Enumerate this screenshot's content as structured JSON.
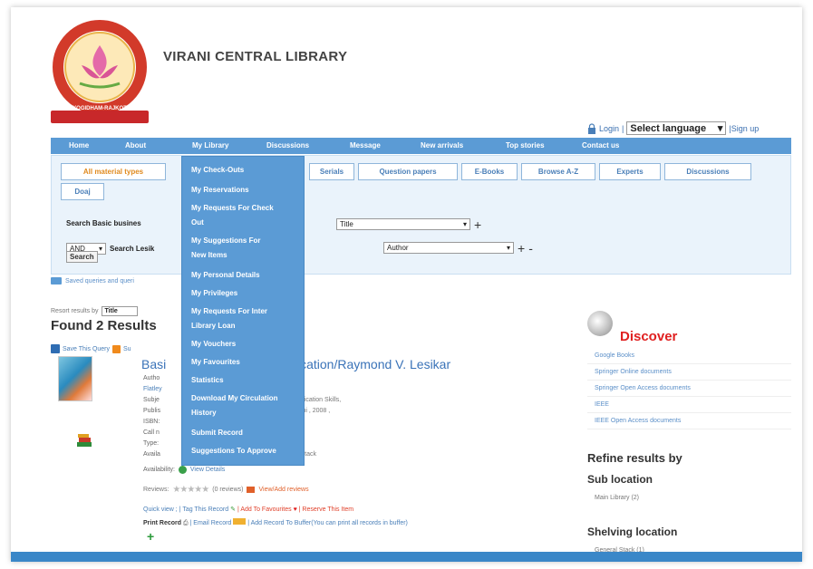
{
  "header": {
    "title": "VIRANI CENTRAL LIBRARY",
    "logo_top_text": "SARVODAY KELAVANI SAMAJ",
    "logo_bottom_text": "YOGIDHAM-RAJKOT",
    "login_label": "Login",
    "language_select": "Select language",
    "signup_label": "|Sign up"
  },
  "nav": {
    "items": [
      "Home",
      "About",
      "My Library",
      "Discussions",
      "Message",
      "New arrivals",
      "Top stories",
      "Contact us"
    ]
  },
  "tabs": [
    "All material types",
    "Serials",
    "Question papers",
    "E-Books",
    "Browse A-Z",
    "Experts",
    "Discussions"
  ],
  "tab_doaj": "Doaj",
  "search": {
    "row1_label": "Search Basic busines",
    "row1_field": "Title",
    "row2_op": "AND",
    "row2_label": "Search Lesik",
    "row2_field": "Author",
    "button": "Search",
    "plus": "+",
    "minus": "-"
  },
  "saved_queries": "Saved queries and queri",
  "resort": {
    "label": "Resort results by",
    "value": "Title"
  },
  "found": "Found 2 Results",
  "save_query": {
    "label": "Save This Query",
    "rss": "Su"
  },
  "record": {
    "title_left": "Basi",
    "title_right": "ication/Raymond V. Lesikar",
    "fields_left": [
      "Autho",
      "Flatley",
      "Subje",
      "Publis",
      "ISBN:",
      "Call n",
      "Type:",
      "Availa"
    ],
    "fields_right": [
      "unication Skills,",
      "elhi , 2008 ,",
      "l Stack"
    ],
    "availability_label": "Availability:",
    "availability_link": "View Details",
    "reviews_label": "Reviews:",
    "reviews_stars": "★★★★★",
    "reviews_count": "(0 reviews)",
    "reviews_link": "View/Add reviews",
    "quick_view": "Quick view ; | Tag This Record",
    "add_favourites": "| Add To Favourites",
    "reserve": "| Reserve This Item",
    "print_record": "Print Record",
    "email_record": "| Email Record",
    "add_buffer": "| Add Record To Buffer(You can print all records in buffer)",
    "plus": "+"
  },
  "sidebar": {
    "discover_title": "Discover",
    "discover_items": [
      "Google Books",
      "Springer Online documents",
      "Springer Open Access documents",
      "IEEE",
      "IEEE Open Access documents"
    ],
    "refine_title": "Refine results by",
    "sub_location_title": "Sub location",
    "sub_location_item": "Main Library (2)",
    "shelving_title": "Shelving location",
    "shelving_item": "General Stack (1)"
  },
  "dropdown": {
    "items": [
      "My Check-Outs",
      "My Reservations",
      "My Requests For Check",
      "Out",
      "My Suggestions For",
      "New Items",
      "My Personal Details",
      "My Privileges",
      "My Requests For Inter",
      "Library Loan",
      "My Vouchers",
      "My Favourites",
      "Statistics",
      "Download My Circulation",
      "History",
      "Submit Record",
      "Suggestions To Approve"
    ]
  }
}
